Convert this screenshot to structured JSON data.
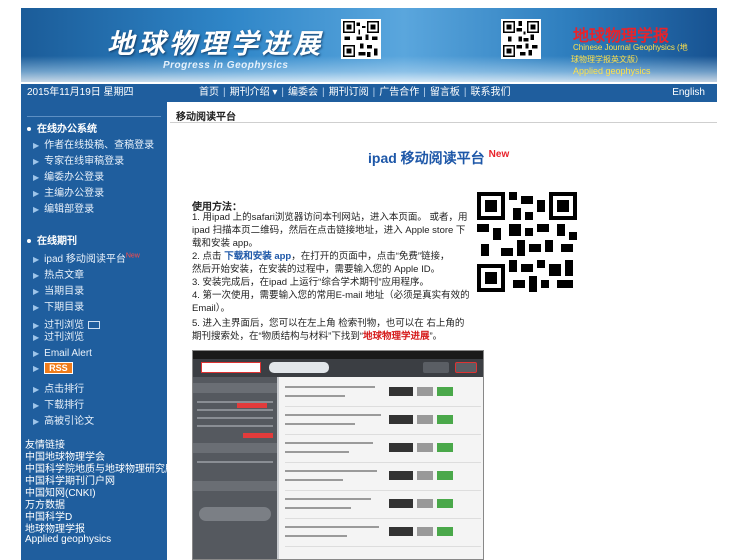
{
  "header": {
    "logo_cn": "地球物理学进展",
    "logo_en": "Progress in Geophysics",
    "sister_cn": "地球物理学报",
    "sister_en1": "Chinese Journal Geophysics (地",
    "sister_en1b": "球物理学报英文版）",
    "sister_en2": "Applied geophysics"
  },
  "navbar": {
    "date": "2015年11月19日 星期四",
    "links": [
      "首页",
      "期刊介绍 ▾",
      "编委会",
      "期刊订阅",
      "广告合作",
      "留言板",
      "联系我们"
    ],
    "lang": "English"
  },
  "sidebar": {
    "section1": "在线办公系统",
    "office": [
      "作者在线投稿、查稿登录",
      "专家在线审稿登录",
      "编委办公登录",
      "主编办公登录",
      "编辑部登录"
    ],
    "section2": "在线期刊",
    "journal": [
      "ipad 移动阅读平台",
      "热点文章",
      "当期目录",
      "下期目录",
      "过刊浏览",
      "过刊浏览",
      "Email Alert",
      "RSS",
      "点击排行",
      "下载排行",
      "高被引论文"
    ],
    "new_badge": "New",
    "links_title": "友情链接",
    "links": [
      "中国地球物理学会",
      "中国科学院地质与地球物理研究所",
      "中国科学期刊门户网",
      "中国知网(CNKI)",
      "万方数据",
      "中国科学D",
      "地球物理学报",
      "Applied geophysics"
    ]
  },
  "main": {
    "breadcrumb": "移动阅读平台",
    "headline": "ipad 移动阅读平台",
    "headline_new": "New",
    "usage_title": "使用方法：",
    "p1a": "1. 用ipad 上的safari浏览器访问本刊网站，进入本页面。 或者，用",
    "p1b": "ipad 扫描本页二维码，然后在点击链接地址，进入 Apple store 下",
    "p1c": "载和安装 app。",
    "p2a_pre": "2. 点击 ",
    "p2a_blue": "下载和安装 app",
    "p2a_post": "，在打开的页面中，点击“免费”链接，",
    "p2b": "然后开始安装，在安装的过程中，需要输入您的 Apple ID。",
    "p3": "3. 安装完成后，在ipad 上运行“综合学术期刊”应用程序。",
    "p4a": "4. 第一次使用，需要输入您的常用E-mail 地址（必须是真实有效的",
    "p4b": "Email）。",
    "p5a": "5. 进入主界面后，您可以在左上角 检索刊物，也可以在 右上角的",
    "p5b_pre": "期刊搜索处，在“物质结构与材料”下找到“",
    "p5b_red": "地球物理学进展",
    "p5b_post": "”。"
  },
  "colors": {
    "nav_blue": "#1f5e9e",
    "link_blue": "#1d57a8",
    "new_red": "#e8232b",
    "sister_yellow": "#ffe14a",
    "rss_orange": "#f07c1a"
  }
}
